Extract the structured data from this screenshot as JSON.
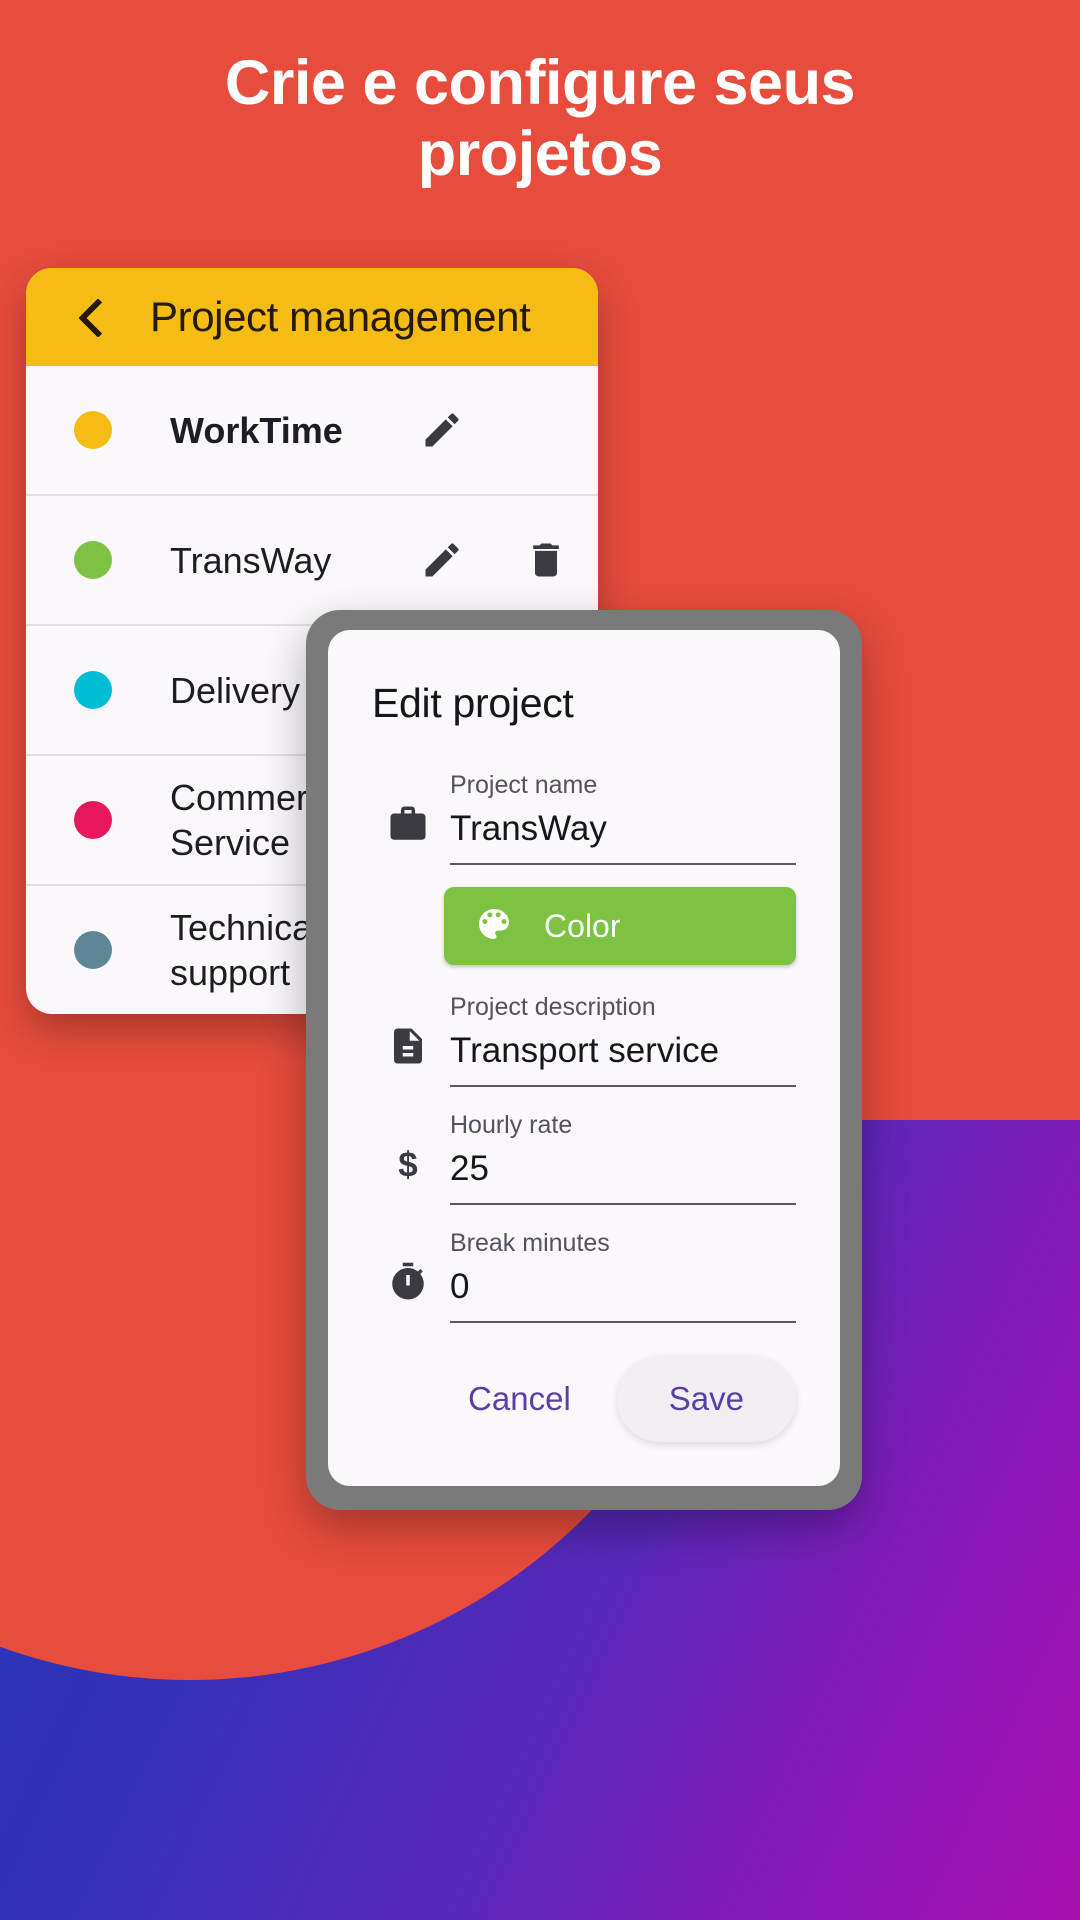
{
  "headline": "Crie e configure seus projetos",
  "colors": {
    "background_red": "#E84C3D",
    "header_yellow": "#F5BC14",
    "accent_green": "#7DC242",
    "action_purple": "#5B3FA8",
    "frame_gray": "#7A7A7A"
  },
  "list_screen": {
    "back_icon": "chevron-left-icon",
    "title": "Project management",
    "projects": [
      {
        "name": "WorkTime",
        "color": "#F5BC14",
        "bold": true,
        "edit_icon": "pencil-icon",
        "delete_icon": "trash-icon",
        "has_delete": false
      },
      {
        "name": "TransWay",
        "color": "#7DC242",
        "bold": false,
        "edit_icon": "pencil-icon",
        "delete_icon": "trash-icon",
        "has_delete": true
      },
      {
        "name": "Delivery",
        "color": "#00BCD4",
        "bold": false,
        "edit_icon": "pencil-icon",
        "delete_icon": "trash-icon",
        "has_delete": true
      },
      {
        "name": "Commercial Service",
        "color": "#E8175D",
        "bold": false,
        "edit_icon": "pencil-icon",
        "delete_icon": "trash-icon",
        "has_delete": true
      },
      {
        "name": "Technical support",
        "color": "#5F8697",
        "bold": false,
        "edit_icon": "pencil-icon",
        "delete_icon": "trash-icon",
        "has_delete": true
      }
    ]
  },
  "dialog": {
    "title": "Edit project",
    "fields": {
      "project_name": {
        "icon": "briefcase-icon",
        "label": "Project name",
        "value": "TransWay"
      },
      "project_description": {
        "icon": "document-icon",
        "label": "Project description",
        "value": "Transport service"
      },
      "hourly_rate": {
        "icon": "dollar-icon",
        "label": "Hourly rate",
        "value": "25"
      },
      "break_minutes": {
        "icon": "stopwatch-icon",
        "label": "Break minutes",
        "value": "0"
      }
    },
    "color_button": {
      "icon": "palette-icon",
      "label": "Color",
      "color": "#7DC242"
    },
    "cancel_label": "Cancel",
    "save_label": "Save"
  }
}
